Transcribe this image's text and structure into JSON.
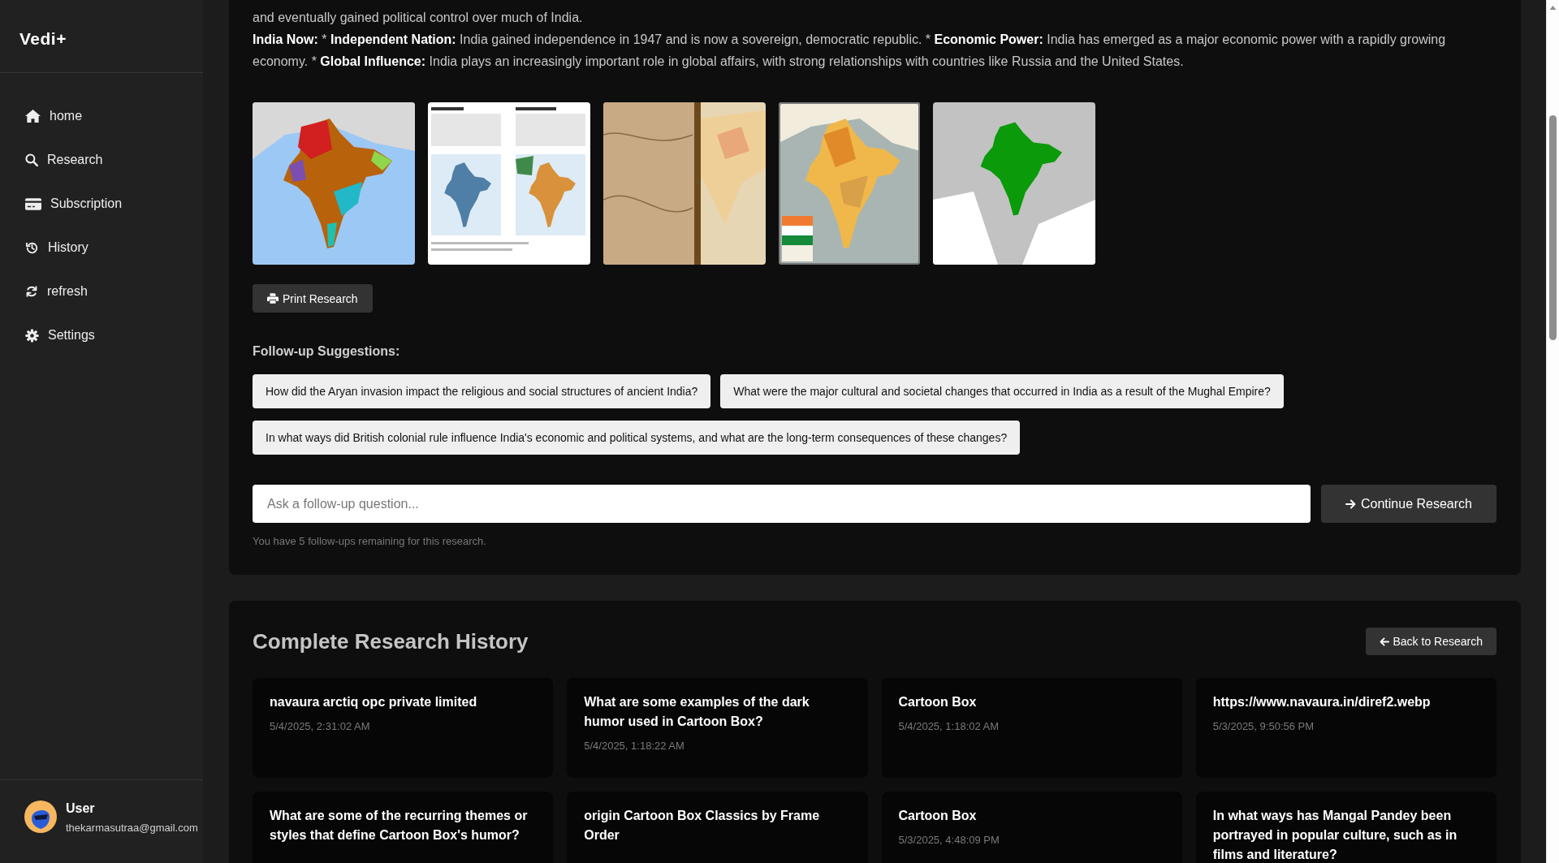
{
  "sidebar": {
    "logo": "Vedi+",
    "items": [
      {
        "label": "home"
      },
      {
        "label": "Research"
      },
      {
        "label": "Subscription"
      },
      {
        "label": "History"
      },
      {
        "label": "refresh"
      },
      {
        "label": "Settings"
      }
    ],
    "user": {
      "name": "User",
      "email": "thekarmasutraa@gmail.com"
    }
  },
  "research": {
    "paragraphs": [
      [
        {
          "text": "and eventually gained political control over much of India.",
          "bold": false
        }
      ],
      [
        {
          "text": "India Now:",
          "bold": true
        },
        {
          "text": " * ",
          "bold": false
        },
        {
          "text": "Independent Nation:",
          "bold": true
        },
        {
          "text": " India gained independence in 1947 and is now a sovereign, democratic republic. * ",
          "bold": false
        },
        {
          "text": "Economic Power:",
          "bold": true
        },
        {
          "text": " India has emerged as a major economic power with a rapidly growing economy. * ",
          "bold": false
        },
        {
          "text": "Global Influence:",
          "bold": true
        },
        {
          "text": " India plays an increasingly important role in global affairs, with strong relationships with countries like Russia and the United States.",
          "bold": false
        }
      ]
    ],
    "images": [
      {
        "kind": "colored_map"
      },
      {
        "kind": "infographic"
      },
      {
        "kind": "antique_map"
      },
      {
        "kind": "province_map"
      },
      {
        "kind": "locator_map"
      }
    ],
    "print_button": "Print Research",
    "followup_heading": "Follow-up Suggestions:",
    "suggestions": [
      "How did the Aryan invasion impact the religious and social structures of ancient India?",
      "What were the major cultural and societal changes that occurred in India as a result of the Mughal Empire?",
      "In what ways did British colonial rule influence India's economic and political systems, and what are the long-term consequences of these changes?"
    ],
    "followup_input": {
      "placeholder": "Ask a follow-up question..."
    },
    "continue_button": "Continue Research",
    "remaining_note": "You have 5 follow-ups remaining for this research."
  },
  "history": {
    "title": "Complete Research History",
    "back_button": "Back to Research",
    "items": [
      {
        "title": "navaura arctiq opc private limited",
        "date": "5/4/2025, 2:31:02 AM"
      },
      {
        "title": "What are some examples of the dark humor used in Cartoon Box?",
        "date": "5/4/2025, 1:18:22 AM"
      },
      {
        "title": "Cartoon Box",
        "date": "5/4/2025, 1:18:02 AM"
      },
      {
        "title": "https://www.navaura.in/diref2.webp",
        "date": "5/3/2025, 9:50:56 PM"
      },
      {
        "title": "What are some of the recurring themes or styles that define Cartoon Box's humor?"
      },
      {
        "title": "origin Cartoon Box Classics by Frame Order"
      },
      {
        "title": "Cartoon Box",
        "date": "5/3/2025, 4:48:09 PM"
      },
      {
        "title": "In what ways has Mangal Pandey been portrayed in popular culture, such as in films and literature?"
      }
    ]
  }
}
